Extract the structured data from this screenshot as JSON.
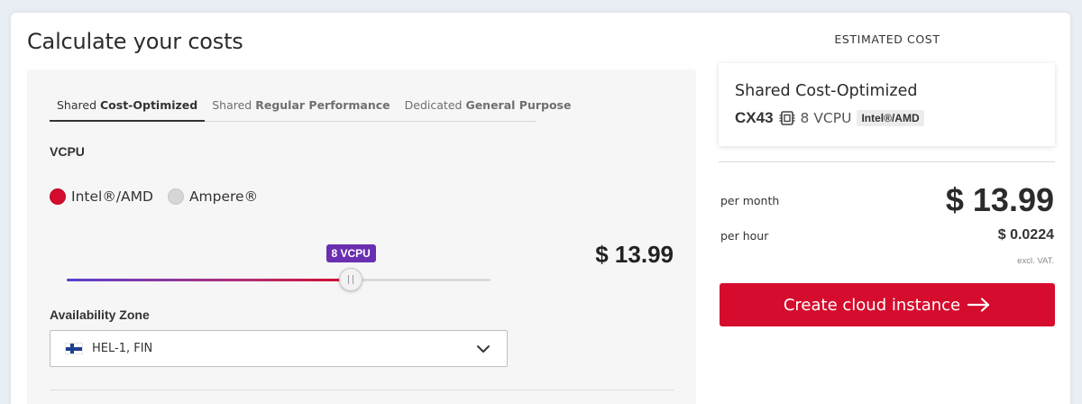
{
  "page": {
    "title": "Calculate your costs"
  },
  "tabs": [
    {
      "prefix": "Shared",
      "bold": "Cost-Optimized",
      "active": true
    },
    {
      "prefix": "Shared",
      "bold": "Regular Performance",
      "active": false
    },
    {
      "prefix": "Dedicated",
      "bold": "General Purpose",
      "active": false
    }
  ],
  "vcpu": {
    "label": "VCPU",
    "options": [
      {
        "label": "Intel®/AMD",
        "checked": true
      },
      {
        "label": "Ampere®",
        "checked": false
      }
    ]
  },
  "slider": {
    "badge": "8 VCPU",
    "value_fraction": 0.67
  },
  "left_price": "$ 13.99",
  "availability": {
    "label": "Availability Zone",
    "value": "HEL-1, FIN",
    "flag_icon": "finland-flag-icon"
  },
  "estimate": {
    "heading": "ESTIMATED COST",
    "plan_name": "Shared Cost-Optimized",
    "server_code": "CX43",
    "cpu_icon": "cpu-chip-icon",
    "vcpu_text": "8 VCPU",
    "arch": "Intel®/AMD",
    "per_month_label": "per month",
    "per_month_value": "$ 13.99",
    "per_hour_label": "per hour",
    "per_hour_value": "$ 0.0224",
    "vat_note": "excl. VAT.",
    "cta_label": "Create cloud instance",
    "cta_icon": "arrow-right-icon"
  },
  "colors": {
    "accent_red": "#d50c2d",
    "badge_purple": "#6a2fb0"
  }
}
